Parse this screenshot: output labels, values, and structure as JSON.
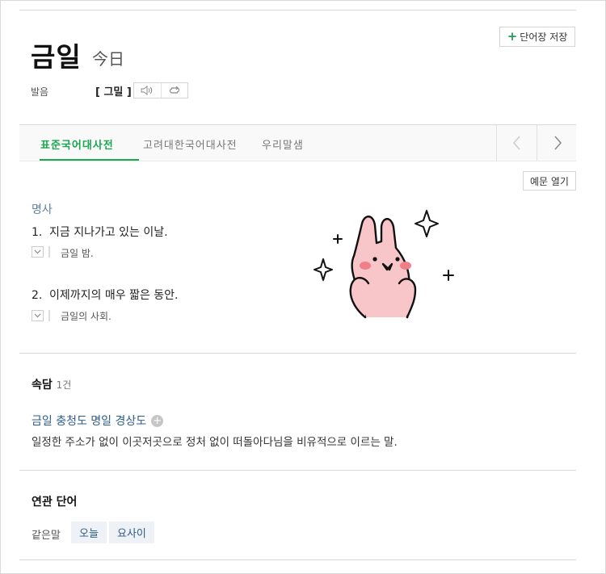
{
  "entry": {
    "headword": "금일",
    "hanja": "今日"
  },
  "actions": {
    "save_plus": "+",
    "save_label": "단어장 저장",
    "example_open_label": "예문 열기"
  },
  "pronunciation": {
    "label": "발음",
    "text": "[ 그밀 ]"
  },
  "tabs": [
    {
      "label": "표준국어대사전",
      "active": true
    },
    {
      "label": "고려대한국어대사전",
      "active": false
    },
    {
      "label": "우리말샘",
      "active": false
    }
  ],
  "definitions": {
    "pos": "명사",
    "items": [
      {
        "num": "1.",
        "text": "지금 지나가고 있는 이날.",
        "example": "금일 밤."
      },
      {
        "num": "2.",
        "text": "이제까지의 매우 짧은 동안.",
        "example": "금일의 사회."
      }
    ]
  },
  "proverb": {
    "title": "속담",
    "count": "1건",
    "phrase": "금일 충청도 명일 경상도",
    "plus": "+",
    "definition": "일정한 주소가 없이 이곳저곳으로 정처 없이 떠돌아다님을 비유적으로 이르는 말."
  },
  "related": {
    "title": "연관 단어",
    "synonym_label": "같은말",
    "synonyms": [
      "오늘",
      "요사이"
    ]
  },
  "colors": {
    "accent_green": "#1aa64f",
    "link_blue": "#2e5c8a",
    "pos_blue": "#5c80a8",
    "sticker_pink": "#f8c6c9"
  }
}
